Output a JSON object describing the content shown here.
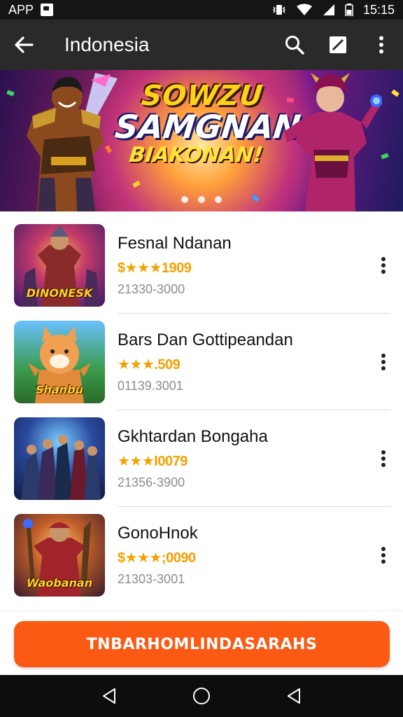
{
  "status_bar": {
    "app_label": "APP",
    "time": "15:15",
    "icons": [
      "notification-icon",
      "vibrate-icon",
      "wifi-icon",
      "signal-icon",
      "battery-icon"
    ]
  },
  "app_bar": {
    "title": "Indonesia",
    "icons": [
      "back-arrow-icon",
      "search-icon",
      "edit-icon",
      "more-vert-icon"
    ]
  },
  "banner": {
    "logo_line1": "SOWZU",
    "logo_line2": "SAMGNAN",
    "logo_line3": "BIAKONAN!",
    "page_count": 3
  },
  "items": [
    {
      "name": "Fesnal Ndanan",
      "rating": "$★★★1909",
      "sub": "21330-3000",
      "thumb_caption": "DINONESK"
    },
    {
      "name": "Bars Dan Gottipeandan",
      "rating": "★★★.509",
      "sub": "01139.3001",
      "thumb_caption": "Shanbu"
    },
    {
      "name": "Gkhtardan Bongaha",
      "rating": "★★★I0079",
      "sub": "21356-3900",
      "thumb_caption": ""
    },
    {
      "name": "GonoHnok",
      "rating": "$★★★;0090",
      "sub": "21303-3001",
      "thumb_caption": "Waobanan"
    }
  ],
  "cta": {
    "label": "TNBARHOMLINDASARAHS"
  },
  "colors": {
    "accent": "#fa5a14",
    "app_bar": "#2a2a2a",
    "rating": "#f5a100"
  }
}
